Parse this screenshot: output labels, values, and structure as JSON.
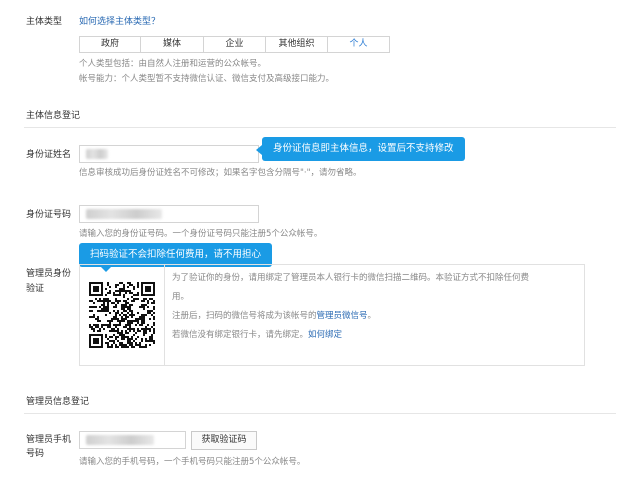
{
  "entity_type": {
    "label": "主体类型",
    "help_link": "如何选择主体类型？",
    "options": [
      "政府",
      "媒体",
      "企业",
      "其他组织",
      "个人"
    ],
    "selected": "个人",
    "desc_line1": "个人类型包括：由自然人注册和运营的公众帐号。",
    "desc_line2": "帐号能力：个人类型暂不支持微信认证、微信支付及高级接口能力。"
  },
  "entity_info": {
    "section_title": "主体信息登记",
    "name_label": "身份证姓名",
    "name_hint": "信息审核成功后身份证姓名不可修改；如果名字包含分隔号\"·\"，请勿省略。",
    "name_tooltip": "身份证信息即主体信息，设置后不支持修改",
    "id_label": "身份证号码",
    "id_hint": "请输入您的身份证号码。一个身份证号码只能注册5个公众帐号。",
    "scan_tooltip": "扫码验证不会扣除任何费用，请不用担心",
    "admin_verify_label_1": "管理员身份",
    "admin_verify_label_2": "验证",
    "verify_text_1": "为了验证你的身份，请用绑定了管理员本人银行卡的微信扫描二维码。本验证方式不扣除任何费",
    "verify_text_2": "用。",
    "verify_text_3_prefix": "注册后，扫码的微信号将成为该帐号的",
    "verify_text_3_link": "管理员微信号",
    "verify_text_3_suffix": "。",
    "verify_text_4_prefix": "若微信没有绑定银行卡，请先绑定。",
    "verify_text_4_link": "如何绑定"
  },
  "admin_info": {
    "section_title": "管理员信息登记",
    "phone_label_1": "管理员手机",
    "phone_label_2": "号码",
    "get_code_button": "获取验证码",
    "phone_hint": "请输入您的手机号码，一个手机号码只能注册5个公众帐号。"
  },
  "colors": {
    "link": "#2a6ab3",
    "tooltip": "#1a9be5",
    "selected_tab": "#2b7cd3"
  }
}
